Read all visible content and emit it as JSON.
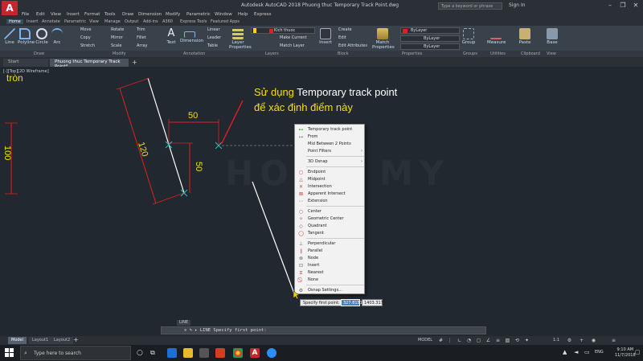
{
  "window": {
    "logo": "A",
    "title": "Autodesk AutoCAD 2018   Phuong thuc Temporary Track Point.dwg",
    "search_placeholder": "Type a keyword or phrase",
    "signin": "Sign In"
  },
  "menubar": [
    "File",
    "Edit",
    "View",
    "Insert",
    "Format",
    "Tools",
    "Draw",
    "Dimension",
    "Modify",
    "Parametric",
    "Window",
    "Help",
    "Express"
  ],
  "ribbon_tabs": [
    "Home",
    "Insert",
    "Annotate",
    "Parametric",
    "View",
    "Manage",
    "Output",
    "Add-ins",
    "A360",
    "Express Tools",
    "Featured Apps"
  ],
  "ribbon": {
    "draw": [
      "Line",
      "Polyline",
      "Circle",
      "Arc"
    ],
    "modify": [
      "Move",
      "Rotate",
      "Trim",
      "Copy",
      "Mirror",
      "Fillet",
      "Stretch",
      "Scale",
      "Array"
    ],
    "annotation": [
      "Text",
      "Dimension",
      "Linear",
      "Leader",
      "Table"
    ],
    "layers": [
      "Layer Properties",
      "Kich thuoc",
      "Make Current",
      "Match Layer"
    ],
    "block": [
      "Insert",
      "Create",
      "Edit",
      "Edit Attributes"
    ],
    "properties": [
      "Match Properties",
      "ByLayer",
      "ByLayer",
      "ByLayer"
    ],
    "groups": "Group",
    "utilities": "Measure",
    "clipboard": "Paste",
    "view": "Base",
    "panel_titles": [
      "Draw",
      "Modify",
      "Annotation",
      "Layers",
      "Block",
      "Properties",
      "Groups",
      "Utilities",
      "Clipboard",
      "View"
    ]
  },
  "doc_tabs": [
    "Start",
    "Phuong thuc Temporary Track Point*"
  ],
  "drawing": {
    "view_label": "[-][Top][2D Wireframe]",
    "corner_text": "tròn",
    "annotation_prefix": "Sử dụng",
    "annotation_suffix": "Temporary track point",
    "annotation_line2": "để xác định điểm này",
    "dim_120": "120",
    "dim_50_top": "50",
    "dim_50_right": "50",
    "dim_100": "100",
    "watermark": "HOAN MY"
  },
  "context_menu": [
    {
      "label": "Temporary track point",
      "icon": "⊷"
    },
    {
      "label": "From",
      "icon": "↦"
    },
    {
      "label": "Mid Between 2 Points",
      "icon": ""
    },
    {
      "label": "Point Filters",
      "icon": "",
      "submenu": true
    },
    {
      "label": "3D Osnap",
      "icon": "",
      "submenu": true
    },
    {
      "label": "Endpoint",
      "icon": "◻"
    },
    {
      "label": "Midpoint",
      "icon": "△"
    },
    {
      "label": "Intersection",
      "icon": "✕"
    },
    {
      "label": "Apparent Intersect",
      "icon": "⊠"
    },
    {
      "label": "Extension",
      "icon": "⋯"
    },
    {
      "label": "Center",
      "icon": "○"
    },
    {
      "label": "Geometric Center",
      "icon": "✧"
    },
    {
      "label": "Quadrant",
      "icon": "◇"
    },
    {
      "label": "Tangent",
      "icon": "◯"
    },
    {
      "label": "Perpendicular",
      "icon": "⊥"
    },
    {
      "label": "Parallel",
      "icon": "∥"
    },
    {
      "label": "Node",
      "icon": "⊗"
    },
    {
      "label": "Insert",
      "icon": "⊡"
    },
    {
      "label": "Nearest",
      "icon": "⧖"
    },
    {
      "label": "None",
      "icon": "⃠"
    },
    {
      "label": "Osnap Settings...",
      "icon": "⚙"
    }
  ],
  "dynamic_input": {
    "prompt": "Specify first point:",
    "x_value": "327.8151",
    "y_value": "1403.3179"
  },
  "command": {
    "previous": "LINE",
    "text": "✕ ✎ ▸  LINE Specify first point:"
  },
  "layout_tabs": [
    "Model",
    "Layout1",
    "Layout2"
  ],
  "status": {
    "model": "MODEL",
    "scale": "1:1"
  },
  "taskbar": {
    "search": "Type here to search",
    "lang": "ENG",
    "time": "9:10 AM",
    "date": "11/7/2018"
  },
  "colors": {
    "accent_yellow": "#f0e000",
    "dimension_red": "#e02020",
    "logo_red": "#c1272d",
    "track_cyan": "#30c0c0"
  }
}
